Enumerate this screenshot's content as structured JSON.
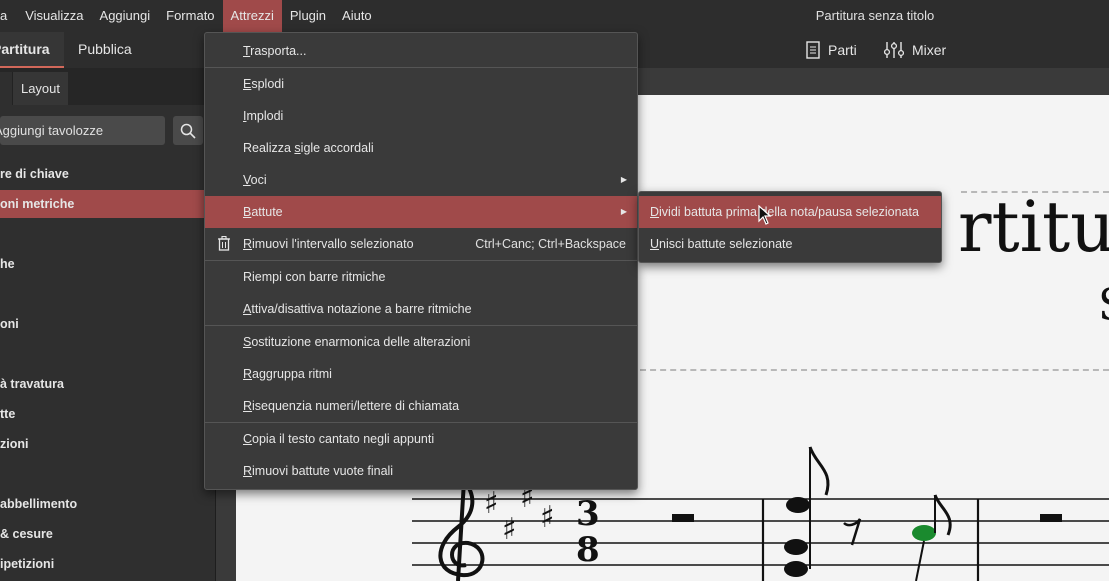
{
  "window": {
    "title": "Partitura senza titolo"
  },
  "menubar": {
    "items": [
      {
        "label": "a",
        "active": false
      },
      {
        "label": "Visualizza",
        "active": false
      },
      {
        "label": "Aggiungi",
        "active": false
      },
      {
        "label": "Formato",
        "active": false
      },
      {
        "label": "Attrezzi",
        "active": true
      },
      {
        "label": "Plugin",
        "active": false
      },
      {
        "label": "Aiuto",
        "active": false
      }
    ]
  },
  "tabs": {
    "partitura": "Partitura",
    "pubblica": "Pubblica",
    "parti": "Parti",
    "mixer": "Mixer"
  },
  "palette": {
    "tabs": {
      "layout": "Layout"
    },
    "search": {
      "placeholder": "Aggiungi tavolozze"
    },
    "items": [
      {
        "label": "re di chiave",
        "selected": false
      },
      {
        "label": "oni metriche",
        "selected": true
      },
      {
        "label": "he",
        "selected": false
      },
      {
        "label": "oni",
        "selected": false
      },
      {
        "label": "à travatura",
        "selected": false
      },
      {
        "label": "tte",
        "selected": false
      },
      {
        "label": "zioni",
        "selected": false
      },
      {
        "label": "abbellimento",
        "selected": false
      },
      {
        "label": "& cesure",
        "selected": false
      },
      {
        "label": "ipetizioni",
        "selected": false
      }
    ]
  },
  "attrezzi_menu": {
    "items": [
      {
        "label": "Trasporta...",
        "underline": "T",
        "rest": "rasporta..."
      },
      {
        "label": "Esplodi",
        "underline": "E",
        "rest": "splodi"
      },
      {
        "label": "Implodi",
        "underline": "I",
        "rest": "mplodi"
      },
      {
        "label": "Realizza sigle accordali",
        "pre": "Realizza ",
        "underline": "s",
        "rest": "igle accordali"
      },
      {
        "label": "Voci",
        "underline": "V",
        "rest": "oci"
      },
      {
        "label": "Battute",
        "underline": "B",
        "rest": "attute"
      },
      {
        "label": "Rimuovi l'intervallo selezionato",
        "underline": "R",
        "rest": "imuovi l'intervallo selezionato",
        "shortcut": "Ctrl+Canc; Ctrl+Backspace"
      },
      {
        "label": "Riempi con barre ritmiche",
        "underline": "",
        "rest": "Riempi con barre ritmiche"
      },
      {
        "label": "Attiva/disattiva notazione a barre ritmiche",
        "underline": "A",
        "rest": "ttiva/disattiva notazione a barre ritmiche"
      },
      {
        "label": "Sostituzione enarmonica delle alterazioni",
        "underline": "S",
        "rest": "ostituzione enarmonica delle alterazioni"
      },
      {
        "label": "Raggruppa ritmi",
        "underline": "R",
        "rest": "aggruppa ritmi"
      },
      {
        "label": "Risequenzia numeri/lettere di chiamata",
        "underline": "R",
        "rest": "isequenzia numeri/lettere di chiamata"
      },
      {
        "label": "Copia il testo cantato negli appunti",
        "underline": "C",
        "rest": "opia il testo cantato negli appunti"
      },
      {
        "label": "Rimuovi battute vuote finali",
        "underline": "R",
        "rest": "imuovi battute vuote finali"
      }
    ]
  },
  "battute_submenu": {
    "items": [
      {
        "label": "Dividi battuta prima della nota/pausa selezionata",
        "underline": "D",
        "rest": "ividi battuta prima della nota/pausa selezionata"
      },
      {
        "label": "Unisci battute selezionate",
        "underline": "U",
        "rest": "nisci battute selezionate"
      }
    ]
  },
  "score": {
    "title_fragment": "rtitur",
    "subtitle_fragment": "S",
    "time_signature": {
      "top": "3",
      "bottom": "8"
    }
  },
  "colors": {
    "accent": "#a04a4a",
    "tab_underline": "#d2685a",
    "selected_note": "#1a8a2e"
  }
}
